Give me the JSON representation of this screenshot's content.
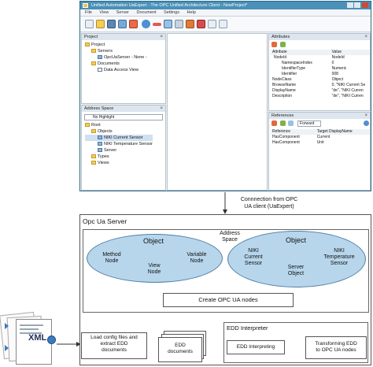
{
  "window": {
    "title": "Unified Automation UaExpert - The OPC Unified Architecture Client - NewProject*",
    "menu": [
      "File",
      "View",
      "Server",
      "Document",
      "Settings",
      "Help"
    ]
  },
  "project_panel": {
    "title": "Project",
    "items": [
      "Project",
      "Servers",
      "OpcUaServer - None -",
      "Documents",
      "Data Access View"
    ]
  },
  "address_panel": {
    "title": "Address Space",
    "filter": "No Highlight",
    "items": [
      "Root",
      "Objects",
      "NIKI Current Sensor",
      "NIKI Temperature Sensor",
      "Server",
      "Types",
      "Views"
    ]
  },
  "attributes_panel": {
    "title": "Attributes",
    "headers": [
      "Attribute",
      "Value"
    ],
    "rows": [
      [
        "NodeId",
        "NodeId"
      ],
      [
        "NamespaceIndex",
        "0"
      ],
      [
        "IdentifierType",
        "Numeric"
      ],
      [
        "Identifier",
        "008"
      ],
      [
        "NodeClass",
        "Object"
      ],
      [
        "BrowseName",
        "0, \"NIKI Current Se"
      ],
      [
        "DisplayName",
        "\"de\", \"NIKI Curren"
      ],
      [
        "Description",
        "\"de\", \"NIKI Curren"
      ]
    ]
  },
  "references_panel": {
    "title": "References",
    "direction": "Forward",
    "headers": [
      "Reference",
      "Target DisplayName"
    ],
    "rows": [
      [
        "HasComponent",
        "Current"
      ],
      [
        "HasComponent",
        "Unit"
      ]
    ]
  },
  "diagram": {
    "connection_label_1": "Connnection from OPC",
    "connection_label_2": "UA client (UaExpert)",
    "server_title": "Opc Ua Server",
    "address_space_1": "Address",
    "address_space_2": "Space",
    "left_object": {
      "title": "Object",
      "method_1": "Method",
      "method_2": "Node",
      "view_1": "View",
      "view_2": "Node",
      "variable_1": "Variable",
      "variable_2": "Node"
    },
    "right_object": {
      "title": "Object",
      "current_1": "NIKI",
      "current_2": "Current",
      "current_3": "Sensor",
      "server_1": "Server",
      "server_2": "Object",
      "temp_1": "NIKI",
      "temp_2": "Temperature",
      "temp_3": "Sensor"
    },
    "create_nodes": "Create OPC UA nodes",
    "xml_label": "XML",
    "load_1": "Load config files and",
    "load_2": "extract EDD",
    "load_3": "documents",
    "edd_docs_1": "EDD",
    "edd_docs_2": "documents",
    "interpreter_title": "EDD Interpreter",
    "interpreting": "EDD Interpreting",
    "transform_1": "Transforming EDD",
    "transform_2": "to OPC UA nodes"
  },
  "colors": {
    "ellipse_fill": "#b7d6ec",
    "ellipse_stroke": "#4f7ea4",
    "titlebar": "#4a90b8"
  }
}
